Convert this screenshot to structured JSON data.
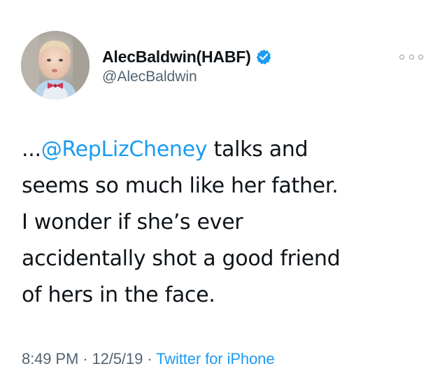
{
  "author": {
    "display_name": "AlecBaldwin(HABF)",
    "handle": "@AlecBaldwin",
    "verified": true
  },
  "tweet": {
    "prefix": "...",
    "mention": "@RepLizCheney",
    "line1_rest": " talks and",
    "line2": "seems so much like her father.",
    "line3": "I wonder if she’s ever",
    "line4": "accidentally shot a good friend",
    "line5": "of hers in the face."
  },
  "meta": {
    "time": "8:49 PM",
    "separator1": " · ",
    "date": "12/5/19",
    "separator2": " · ",
    "source": "Twitter for iPhone"
  },
  "icons": {
    "verified": "verified-badge-icon",
    "more": "more-options-icon"
  },
  "colors": {
    "accent": "#1d9bf0",
    "text": "#0f1419",
    "muted": "#536471"
  }
}
